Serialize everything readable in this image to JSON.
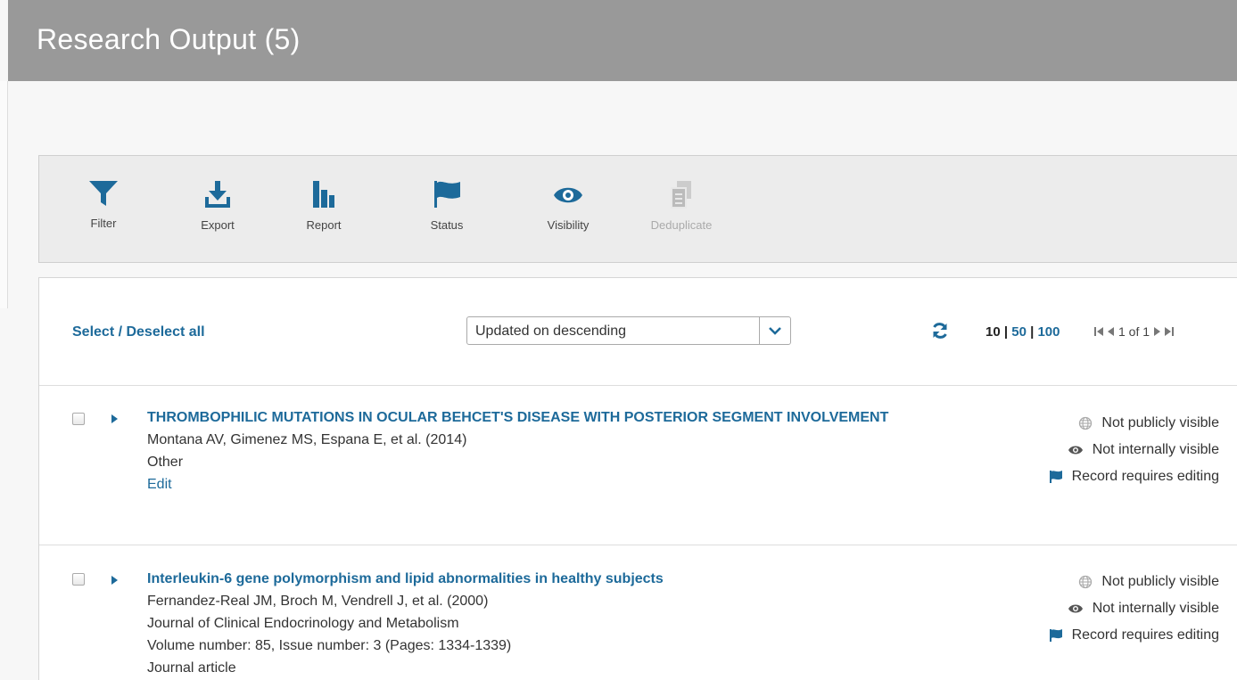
{
  "header": {
    "title": "Research Output (5)"
  },
  "toolbar": {
    "filter": "Filter",
    "export": "Export",
    "report": "Report",
    "status": "Status",
    "visibility": "Visibility",
    "deduplicate": "Deduplicate"
  },
  "controls": {
    "select_all": "Select / Deselect all",
    "sort_value": "Updated on descending",
    "page_size_current": "10",
    "page_size_50": "50",
    "page_size_100": "100",
    "separator": "|",
    "page_info": "1 of 1"
  },
  "items": [
    {
      "title": "THROMBOPHILIC MUTATIONS IN OCULAR BEHCET'S DISEASE WITH POSTERIOR SEGMENT INVOLVEMENT",
      "authors": "Montana AV, Gimenez MS, Espana E, et al. (2014)",
      "type": "Other",
      "edit": "Edit",
      "public_status": "Not publicly visible",
      "internal_status": "Not internally visible",
      "record_status": "Record requires editing"
    },
    {
      "title": "Interleukin-6 gene polymorphism and lipid abnormalities in healthy subjects",
      "authors": "Fernandez-Real JM, Broch M, Vendrell J, et al. (2000)",
      "journal": "Journal of Clinical Endocrinology and Metabolism",
      "volume": "Volume number: 85, Issue number: 3 (Pages: 1334-1339)",
      "type": "Journal article",
      "public_status": "Not publicly visible",
      "internal_status": "Not internally visible",
      "record_status": "Record requires editing"
    }
  ],
  "colors": {
    "accent": "#1d6a9a",
    "header": "#999999"
  }
}
